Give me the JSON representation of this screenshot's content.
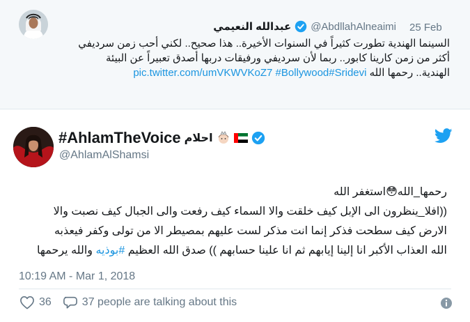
{
  "quoted_tweet": {
    "date": "25 Feb",
    "display_name": "عبدالله النعيمي",
    "handle": "@AbdllahAlneaimi",
    "lines": [
      "السينما الهندية تطورت كثيراً في السنوات الأخيرة.. هذا صحيح.. لكني أحب زمن سرديفي",
      "أكثر من زمن كارينا كابور.. ربما لأن سرديفي ورفيقات دربها أصدق تعبيراً عن البيئة"
    ],
    "last_line_text": "الهندية.. رحمها الله",
    "hashtags": [
      "#Sridevi",
      "#Bollywood"
    ],
    "link": "pic.twitter.com/umVKWVKoZ7"
  },
  "tweet": {
    "display_name": "#AhlamTheVoice",
    "display_name_ar": "احلام",
    "handle": "@AhlamAlShamsi",
    "lines": [
      "رحمها_الله😳استغفر الله",
      "((افلا_ينظرون الى الإبل كيف خلقت والا السماء كيف رفعت والى الجبال كيف نصبت والا",
      "الارض كيف سطحت فذكر إنما انت مذكر لست عليهم بمصيطر الا من تولى وكفر فيعذبه",
      "الله العذاب الأكبر انا إلينا إيابهم ثم انا علينا حسابهم )) صدق الله العظيم"
    ],
    "last_line_hashtag": "#بوذيه",
    "last_line_end": "والله يرحمها",
    "timestamp": "10:19 AM - Mar 1, 2018",
    "likes": "36",
    "talking": "37 people are talking about this"
  },
  "colors": {
    "link": "#1b95e0",
    "muted": "#657786",
    "twitter_blue": "#1da1f2",
    "quoted_bg": "#f5f8fa"
  },
  "icons": [
    "verified-badge-icon",
    "twitter-bird-icon",
    "heart-icon",
    "reply-bubble-icon",
    "info-icon",
    "uae-flag-icon",
    "woman-emoji-icon"
  ]
}
